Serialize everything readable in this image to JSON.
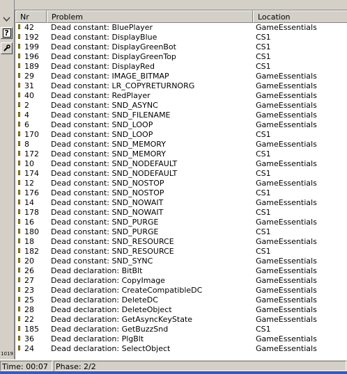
{
  "toolbar": {
    "items": [
      {
        "icon": "chevron-down-icon"
      },
      {
        "icon": "help-icon",
        "glyph": "?"
      },
      {
        "icon": "wrench-icon"
      }
    ],
    "counter": "1019"
  },
  "columns": {
    "nr": "Nr",
    "problem": "Problem",
    "location": "Location"
  },
  "rows": [
    {
      "nr": "42",
      "problem": "Dead constant: BluePlayer",
      "location": "GameEssentials"
    },
    {
      "nr": "192",
      "problem": "Dead constant: DisplayBlue",
      "location": "CS1"
    },
    {
      "nr": "199",
      "problem": "Dead constant: DisplayGreenBot",
      "location": "CS1"
    },
    {
      "nr": "196",
      "problem": "Dead constant: DisplayGreenTop",
      "location": "CS1"
    },
    {
      "nr": "189",
      "problem": "Dead constant: DisplayRed",
      "location": "CS1"
    },
    {
      "nr": "29",
      "problem": "Dead constant: IMAGE_BITMAP",
      "location": "GameEssentials"
    },
    {
      "nr": "31",
      "problem": "Dead constant: LR_COPYRETURNORG",
      "location": "GameEssentials"
    },
    {
      "nr": "40",
      "problem": "Dead constant: RedPlayer",
      "location": "GameEssentials"
    },
    {
      "nr": "2",
      "problem": "Dead constant: SND_ASYNC",
      "location": "GameEssentials"
    },
    {
      "nr": "4",
      "problem": "Dead constant: SND_FILENAME",
      "location": "GameEssentials"
    },
    {
      "nr": "6",
      "problem": "Dead constant: SND_LOOP",
      "location": "GameEssentials"
    },
    {
      "nr": "170",
      "problem": "Dead constant: SND_LOOP",
      "location": "CS1"
    },
    {
      "nr": "8",
      "problem": "Dead constant: SND_MEMORY",
      "location": "GameEssentials"
    },
    {
      "nr": "172",
      "problem": "Dead constant: SND_MEMORY",
      "location": "CS1"
    },
    {
      "nr": "10",
      "problem": "Dead constant: SND_NODEFAULT",
      "location": "GameEssentials"
    },
    {
      "nr": "174",
      "problem": "Dead constant: SND_NODEFAULT",
      "location": "CS1"
    },
    {
      "nr": "12",
      "problem": "Dead constant: SND_NOSTOP",
      "location": "GameEssentials"
    },
    {
      "nr": "176",
      "problem": "Dead constant: SND_NOSTOP",
      "location": "CS1"
    },
    {
      "nr": "14",
      "problem": "Dead constant: SND_NOWAIT",
      "location": "GameEssentials"
    },
    {
      "nr": "178",
      "problem": "Dead constant: SND_NOWAIT",
      "location": "CS1"
    },
    {
      "nr": "16",
      "problem": "Dead constant: SND_PURGE",
      "location": "GameEssentials"
    },
    {
      "nr": "180",
      "problem": "Dead constant: SND_PURGE",
      "location": "CS1"
    },
    {
      "nr": "18",
      "problem": "Dead constant: SND_RESOURCE",
      "location": "GameEssentials"
    },
    {
      "nr": "182",
      "problem": "Dead constant: SND_RESOURCE",
      "location": "CS1"
    },
    {
      "nr": "20",
      "problem": "Dead constant: SND_SYNC",
      "location": "GameEssentials"
    },
    {
      "nr": "26",
      "problem": "Dead declaration: BitBlt",
      "location": "GameEssentials"
    },
    {
      "nr": "27",
      "problem": "Dead declaration: CopyImage",
      "location": "GameEssentials"
    },
    {
      "nr": "23",
      "problem": "Dead declaration: CreateCompatibleDC",
      "location": "GameEssentials"
    },
    {
      "nr": "25",
      "problem": "Dead declaration: DeleteDC",
      "location": "GameEssentials"
    },
    {
      "nr": "28",
      "problem": "Dead declaration: DeleteObject",
      "location": "GameEssentials"
    },
    {
      "nr": "22",
      "problem": "Dead declaration: GetAsyncKeyState",
      "location": "GameEssentials"
    },
    {
      "nr": "185",
      "problem": "Dead declaration: GetBuzzSnd",
      "location": "CS1"
    },
    {
      "nr": "36",
      "problem": "Dead declaration: PlgBlt",
      "location": "GameEssentials"
    },
    {
      "nr": "24",
      "problem": "Dead declaration: SelectObject",
      "location": "GameEssentials"
    }
  ],
  "status": {
    "time": "Time: 00:07",
    "phase": "Phase: 2/2"
  },
  "colors": {
    "warning_marker": "#c8a000",
    "taskbar": "#2a5bd7"
  }
}
